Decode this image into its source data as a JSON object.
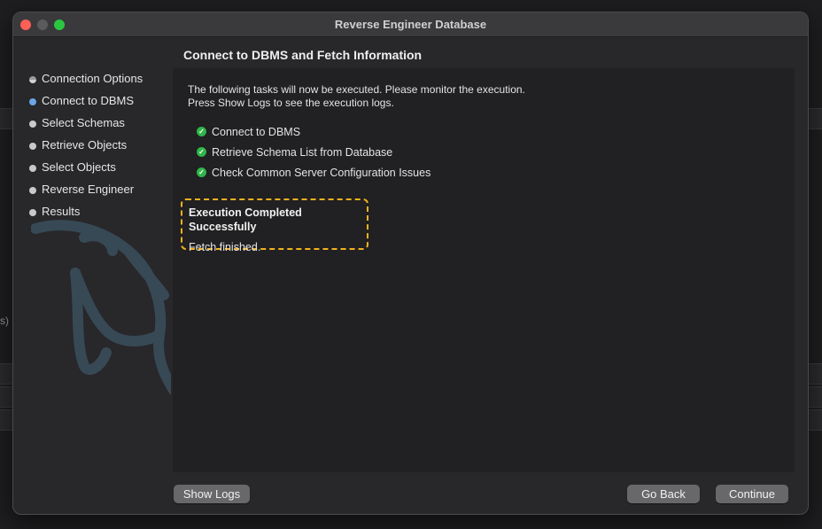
{
  "window": {
    "title": "Reverse Engineer Database"
  },
  "background": {
    "partial_text": "s)"
  },
  "sidebar": {
    "steps": [
      {
        "label": "Connection Options",
        "state": "done"
      },
      {
        "label": "Connect to DBMS",
        "state": "active"
      },
      {
        "label": "Select Schemas",
        "state": "pending"
      },
      {
        "label": "Retrieve Objects",
        "state": "pending"
      },
      {
        "label": "Select Objects",
        "state": "pending"
      },
      {
        "label": "Reverse Engineer",
        "state": "pending"
      },
      {
        "label": "Results",
        "state": "pending"
      }
    ]
  },
  "main": {
    "title": "Connect to DBMS and Fetch Information",
    "intro_line1": "The following tasks will now be executed. Please monitor the execution.",
    "intro_line2": "Press Show Logs to see the execution logs.",
    "tasks": [
      {
        "label": "Connect to DBMS",
        "status": "success"
      },
      {
        "label": "Retrieve Schema List from Database",
        "status": "success"
      },
      {
        "label": "Check Common Server Configuration Issues",
        "status": "success"
      }
    ],
    "result_title": "Execution Completed Successfully",
    "result_status": "Fetch finished."
  },
  "buttons": {
    "show_logs": "Show Logs",
    "go_back": "Go Back",
    "continue": "Continue"
  },
  "colors": {
    "highlight_border": "#f2b31d",
    "success": "#2fb54a",
    "active_step": "#6aa6e6"
  },
  "icons": {
    "check": "check-circle-icon",
    "watermark": "dolphin-logo"
  }
}
